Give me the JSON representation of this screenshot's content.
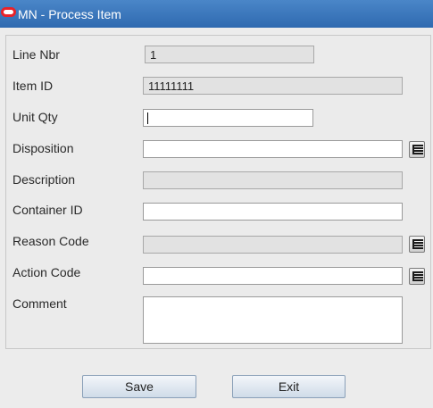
{
  "window": {
    "title": "MN - Process Item"
  },
  "form": {
    "line_nbr": {
      "label": "Line Nbr",
      "value": "1"
    },
    "item_id": {
      "label": "Item ID",
      "value": "11111111"
    },
    "unit_qty": {
      "label": "Unit Qty",
      "value": ""
    },
    "disposition": {
      "label": "Disposition",
      "value": ""
    },
    "description": {
      "label": "Description",
      "value": ""
    },
    "container_id": {
      "label": "Container ID",
      "value": ""
    },
    "reason_code": {
      "label": "Reason Code",
      "value": ""
    },
    "action_code": {
      "label": "Action Code",
      "value": ""
    },
    "comment": {
      "label": "Comment",
      "value": ""
    }
  },
  "buttons": {
    "save": "Save",
    "exit": "Exit"
  },
  "icons": {
    "logo": "oracle-logo-icon",
    "lookup": "list-lookup-icon"
  },
  "colors": {
    "titlebar": "#3a77bd",
    "logo": "#e8232a"
  }
}
